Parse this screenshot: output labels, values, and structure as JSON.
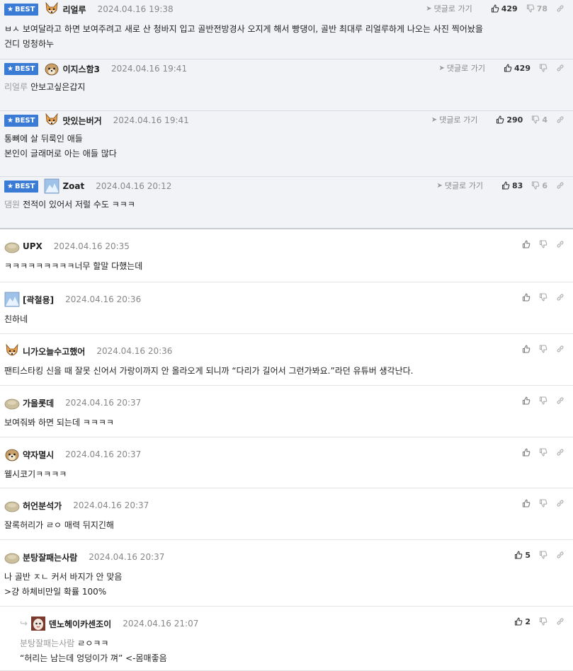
{
  "best_label": "BEST",
  "goto_label": "댓글로 가기",
  "best_comments": [
    {
      "nick": "리얼루",
      "date": "2024.04.16 19:38",
      "avatar": "dog",
      "up": "429",
      "down": "78",
      "lines": [
        "ㅂㅅ 보여달라고 하면 보여주려고 새로 산 청바지 입고 골반전방경사 오지게 해서 빵댕이, 골반 최대루 리얼루하게 나오는 사진 찍어놨을",
        "건디 멍청하누"
      ]
    },
    {
      "nick": "이지스함3",
      "date": "2024.04.16 19:41",
      "avatar": "pup",
      "up": "429",
      "down": "",
      "ref": "리얼루",
      "lines": [
        "안보고싶은갑지"
      ]
    },
    {
      "nick": "맛있는버거",
      "date": "2024.04.16 19:41",
      "avatar": "dog",
      "up": "290",
      "down": "4",
      "lines": [
        "통뼈에 살 뒤룩인 애들",
        "본인이 글래머로 아는 애들 많다"
      ]
    },
    {
      "nick": "Zoat",
      "date": "2024.04.16 20:12",
      "avatar": "photo",
      "up": "83",
      "down": "6",
      "ref": "댐원",
      "lines": [
        "전적이 있어서 저럴 수도 ㅋㅋㅋ"
      ]
    }
  ],
  "comments": [
    {
      "nick": "UPX",
      "date": "2024.04.16 20:35",
      "avatar": "blob",
      "up": "",
      "lines": [
        "ㅋㅋㅋㅋㅋㅋㅋㅋㅋ너무 할말 다했는데"
      ]
    },
    {
      "nick": "[곽철용]",
      "date": "2024.04.16 20:36",
      "avatar": "photo",
      "up": "",
      "lines": [
        "친하네"
      ]
    },
    {
      "nick": "니가오늘수고했어",
      "date": "2024.04.16 20:36",
      "avatar": "dog",
      "up": "",
      "lines": [
        "팬티스타킹 신을 때 잘못 신어서 가랑이까지 안 올라오게 되니까 “다리가 길어서 그런가봐요.”라던 유튜버 생각난다."
      ]
    },
    {
      "nick": "가을롯데",
      "date": "2024.04.16 20:37",
      "avatar": "blob",
      "up": "",
      "lines": [
        "보여줘봐 하면 되는데 ㅋㅋㅋㅋ"
      ]
    },
    {
      "nick": "약자멸시",
      "date": "2024.04.16 20:37",
      "avatar": "pup",
      "up": "",
      "lines": [
        "웰시코기ㅋㅋㅋㅋ"
      ]
    },
    {
      "nick": "허언분석가",
      "date": "2024.04.16 20:37",
      "avatar": "blob",
      "up": "",
      "lines": [
        "잘록허리가 ㄹㅇ 매력 뒤지긴해"
      ]
    },
    {
      "nick": "분탕잘패는사람",
      "date": "2024.04.16 20:37",
      "avatar": "blob",
      "up": "5",
      "lines": [
        "나 골반 ㅈㄴ 커서 바지가 안 맞음",
        ">걍 하체비만일 확률 100%"
      ]
    },
    {
      "nick": "덴노헤이카센조이",
      "date": "2024.04.16 21:07",
      "avatar": "face",
      "up": "2",
      "reply": true,
      "ref": "분탕잘패는사람",
      "lines": [
        "ㄹㅇㅋㅋ",
        "“허리는 남는데 엉덩이가 껴” <-몸매좋음"
      ]
    }
  ]
}
